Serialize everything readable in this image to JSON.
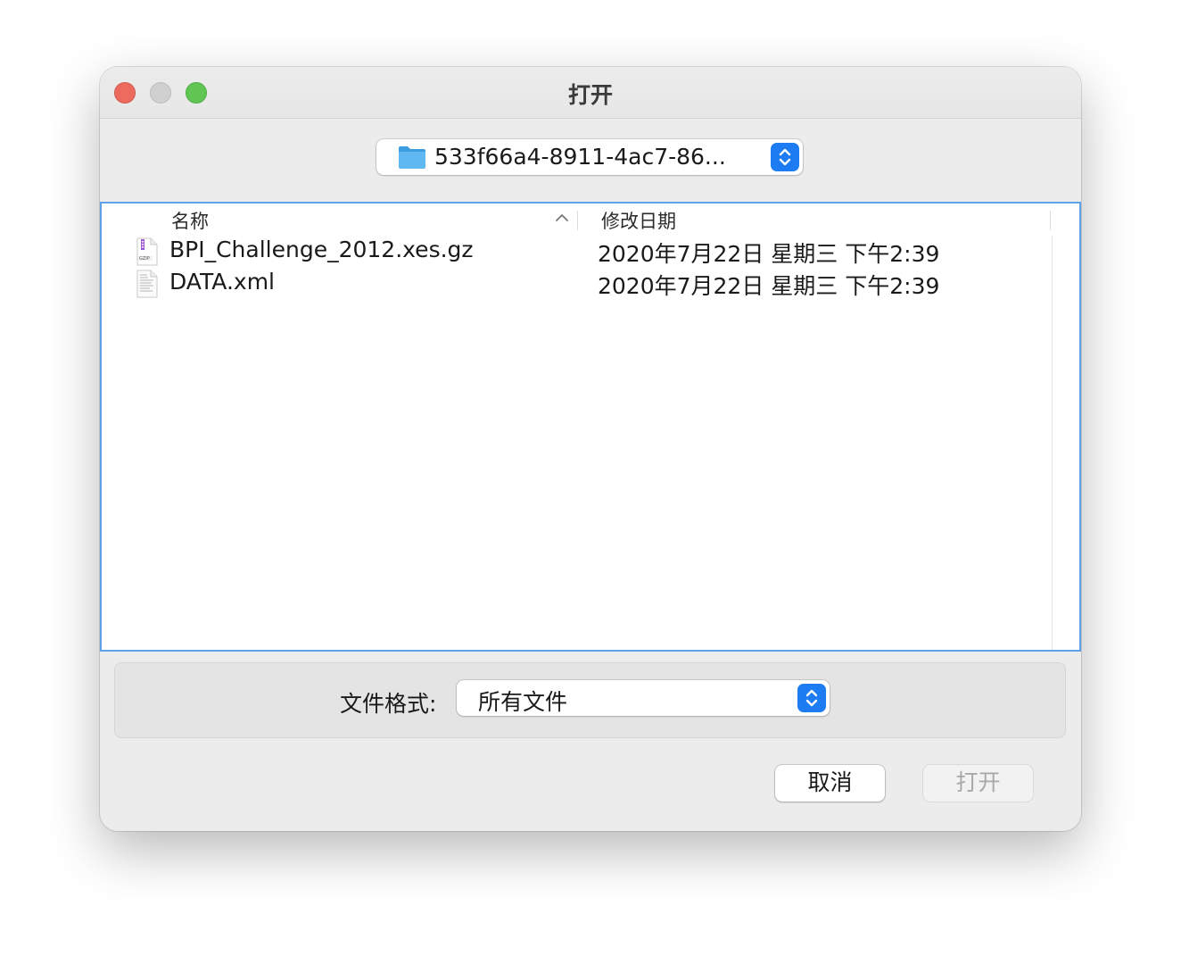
{
  "window": {
    "title": "打开"
  },
  "location": {
    "folder_name": "533f66a4-8911-4ac7-86...",
    "folder_icon": "folder-icon"
  },
  "columns": {
    "name": "名称",
    "date_modified": "修改日期",
    "sort_direction": "ascending"
  },
  "files": [
    {
      "name": "BPI_Challenge_2012.xes.gz",
      "date": "2020年7月22日 星期三 下午2:39",
      "icon": "gzip-archive-icon"
    },
    {
      "name": "DATA.xml",
      "date": "2020年7月22日 星期三 下午2:39",
      "icon": "xml-document-icon"
    }
  ],
  "format": {
    "label": "文件格式:",
    "selected": "所有文件"
  },
  "buttons": {
    "cancel": "取消",
    "open": "打开"
  },
  "colors": {
    "accent": "#1d7cf2",
    "list_focus_border": "#5fa1e8",
    "close": "#ed6a5e",
    "zoom": "#61c554"
  }
}
